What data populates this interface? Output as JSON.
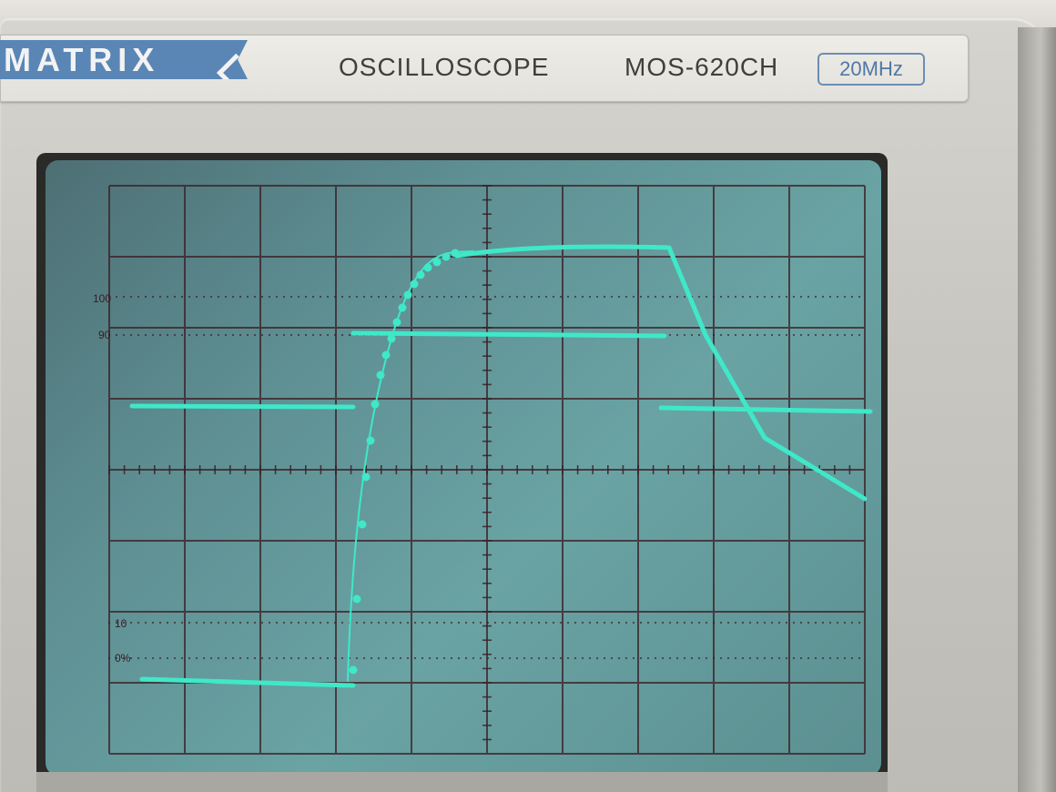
{
  "brand": {
    "logo_text": "MATRIX"
  },
  "panel": {
    "device_type": "OSCILLOSCOPE",
    "model": "MOS-620CH",
    "bandwidth": "20MHz"
  },
  "graticule_labels": {
    "l100": "100",
    "l90": "90",
    "l10": "10",
    "l0": "0%"
  },
  "colors": {
    "trace": "#3fe8c8",
    "screen": "#6aa3a4",
    "grid": "#3a1c22",
    "logo": "#5a86b6"
  }
}
